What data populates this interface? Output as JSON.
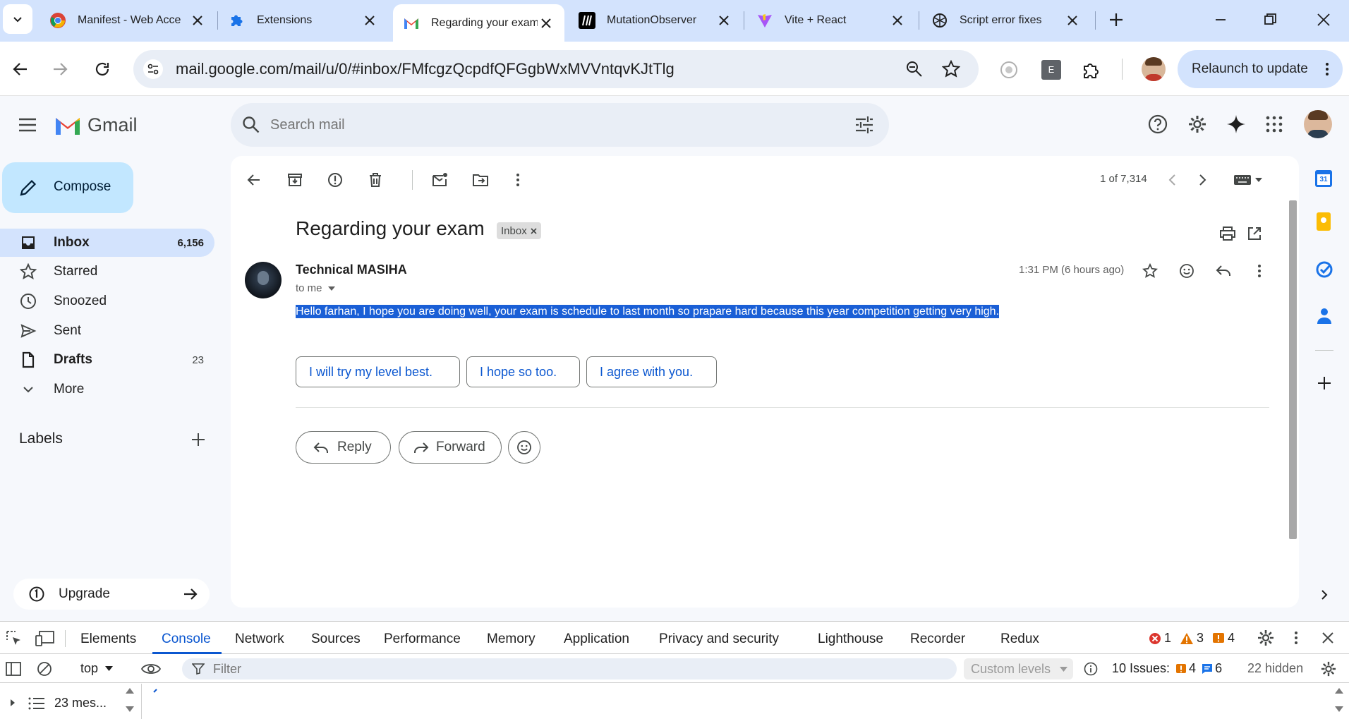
{
  "browser": {
    "tabs": [
      {
        "title": "Manifest - Web Acce",
        "icon": "chrome-icon"
      },
      {
        "title": "Extensions",
        "icon": "puzzle-icon"
      },
      {
        "title": "Regarding your exam",
        "icon": "gmail-icon",
        "active": true
      },
      {
        "title": "MutationObserver",
        "icon": "mdn-icon"
      },
      {
        "title": "Vite + React",
        "icon": "vite-icon"
      },
      {
        "title": "Script error fixes",
        "icon": "openai-icon"
      }
    ],
    "url": "mail.google.com/mail/u/0/#inbox/FMfcgzQcpdfQFGgbWxMVVntqvKJtTlg",
    "relaunch_label": "Relaunch to update",
    "extension_letter": "E"
  },
  "gmail": {
    "logo_text": "Gmail",
    "search_placeholder": "Search mail",
    "compose_label": "Compose",
    "nav": [
      {
        "label": "Inbox",
        "count": "6,156",
        "icon": "inbox-icon"
      },
      {
        "label": "Starred",
        "count": "",
        "icon": "star-icon"
      },
      {
        "label": "Snoozed",
        "count": "",
        "icon": "clock-icon"
      },
      {
        "label": "Sent",
        "count": "",
        "icon": "send-icon"
      },
      {
        "label": "Drafts",
        "count": "23",
        "icon": "draft-icon"
      },
      {
        "label": "More",
        "count": "",
        "icon": "chevron-down-icon"
      }
    ],
    "labels_heading": "Labels",
    "upgrade_label": "Upgrade",
    "pagination": "1 of 7,314",
    "email": {
      "subject": "Regarding your exam",
      "label_chip": "Inbox",
      "sender": "Technical MASIHA",
      "recipient": "to me",
      "time": "1:31 PM (6 hours ago)",
      "body": "Hello farhan, I hope you are doing well, your exam is schedule to last month so prapare hard because this year competition getting very high."
    },
    "smart_replies": [
      "I will try my level best.",
      "I hope so too.",
      "I agree with you."
    ],
    "reply_label": "Reply",
    "forward_label": "Forward"
  },
  "devtools": {
    "tabs": [
      "Elements",
      "Console",
      "Network",
      "Sources",
      "Performance",
      "Memory",
      "Application",
      "Privacy and security",
      "Lighthouse",
      "Recorder",
      "Redux"
    ],
    "active_tab": "Console",
    "errors": "1",
    "warnings": "3",
    "infos": "4",
    "context": "top",
    "filter_placeholder": "Filter",
    "levels": "Custom levels",
    "issues_label": "10 Issues:",
    "issues_warn": "4",
    "issues_info": "6",
    "hidden": "22 hidden",
    "messages": "23 mes..."
  },
  "colors": {
    "tabstrip": "#d3e3fd",
    "gmail_bg": "#f6f8fc",
    "compose": "#c2e7ff",
    "selection": "#1a5fd6",
    "link": "#0b57d0"
  }
}
